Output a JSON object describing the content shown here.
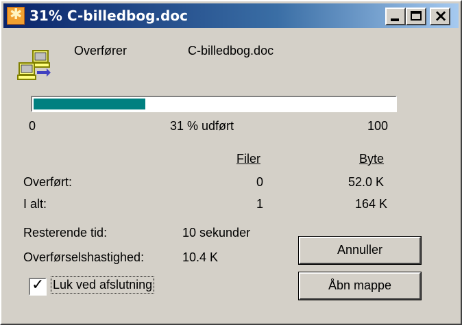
{
  "window": {
    "title": "31% C-billedbog.doc",
    "icon": "transfer-star-icon"
  },
  "titlebar_buttons": {
    "minimize": "minimize-icon",
    "maximize": "maximize-icon",
    "close": "close-icon"
  },
  "header": {
    "status_label": "Overfører",
    "file_name": "C-billedbog.doc",
    "icon": "computers-transfer-icon"
  },
  "progress": {
    "value_percent": 31,
    "min_label": "0",
    "mid_label": "31 % udført",
    "max_label": "100",
    "fill_color": "#008080"
  },
  "stats": {
    "col_files": "Filer",
    "col_bytes": "Byte",
    "rows": [
      {
        "label": "Overført:",
        "files": "0",
        "bytes": "52.0 K"
      },
      {
        "label": "I alt:",
        "files": "1",
        "bytes": "164 K"
      }
    ]
  },
  "time": {
    "remaining_label": "Resterende tid:",
    "remaining_value": "10 sekunder",
    "speed_label": "Overførselshastighed:",
    "speed_value": "10.4 K"
  },
  "buttons": {
    "cancel": "Annuller",
    "open_folder": "Åbn mappe"
  },
  "close_on_finish": {
    "label": "Luk ved afslutning",
    "checked": true
  }
}
